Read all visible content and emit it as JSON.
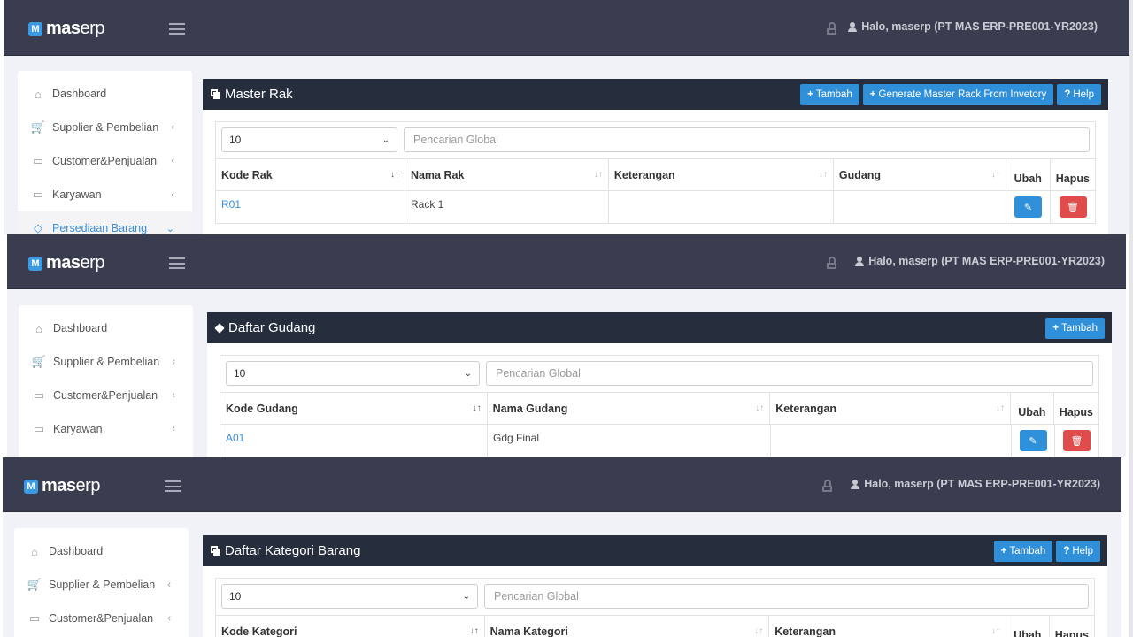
{
  "app": {
    "logo_mark": "M",
    "logo_bold": "mas",
    "logo_thin": "erp",
    "user_greeting": "Halo, maserp (PT MAS ERP-PRE001-YR2023)"
  },
  "sidebar": {
    "items": [
      {
        "label": "Dashboard",
        "icon": "home-icon",
        "glyph": "⌂",
        "chevron": ""
      },
      {
        "label": "Supplier & Pembelian",
        "icon": "cart-icon",
        "glyph": "🛒",
        "chevron": "‹"
      },
      {
        "label": "Customer&Penjualan",
        "icon": "card-icon",
        "glyph": "▭",
        "chevron": "‹"
      },
      {
        "label": "Karyawan",
        "icon": "card-icon",
        "glyph": "▭",
        "chevron": "‹"
      },
      {
        "label": "Persediaan Barang",
        "icon": "tag-icon",
        "glyph": "◇",
        "chevron": "⌄"
      }
    ]
  },
  "panels": [
    {
      "title": "Master Rak",
      "buttons": [
        {
          "label": "Tambah",
          "glyph": "+"
        },
        {
          "label": "Generate Master Rack From Invetory",
          "glyph": "+"
        },
        {
          "label": "Help",
          "glyph": "?"
        }
      ],
      "page_size": "10",
      "search_placeholder": "Pencarian Global",
      "columns": [
        "Kode Rak",
        "Nama Rak",
        "Keterangan",
        "Gudang",
        "Ubah",
        "Hapus"
      ],
      "rows": [
        [
          "R01",
          "Rack 1",
          "",
          ""
        ]
      ]
    },
    {
      "title": "Daftar Gudang",
      "buttons": [
        {
          "label": "Tambah",
          "glyph": "+"
        }
      ],
      "page_size": "10",
      "search_placeholder": "Pencarian Global",
      "columns": [
        "Kode Gudang",
        "Nama Gudang",
        "Keterangan",
        "Ubah",
        "Hapus"
      ],
      "rows": [
        [
          "A01",
          "Gdg Final",
          ""
        ]
      ]
    },
    {
      "title": "Daftar Kategori Barang",
      "buttons": [
        {
          "label": "Tambah",
          "glyph": "+"
        },
        {
          "label": "Help",
          "glyph": "?"
        }
      ],
      "page_size": "10",
      "search_placeholder": "Pencarian Global",
      "columns": [
        "Kode Kategori",
        "Nama Kategori",
        "Keterangan",
        "Ubah",
        "Hapus"
      ],
      "rows": []
    }
  ],
  "colors": {
    "topbar": "#3a3d4f",
    "card_header": "#262d3d",
    "primary": "#2f8fd8",
    "danger": "#e04b4b"
  }
}
